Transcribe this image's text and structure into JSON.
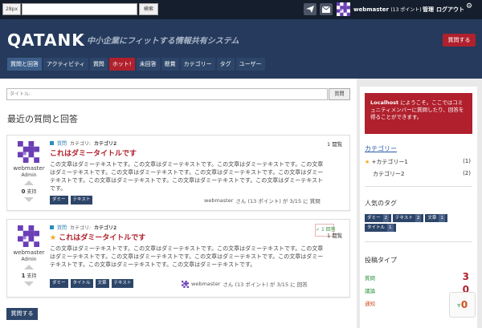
{
  "topbar": {
    "logo_text": "28px",
    "search_button": "検索",
    "user_name": "webmaster",
    "user_points": "(13 ポイント)",
    "admin_link": "管理",
    "logout_link": "ログアウト"
  },
  "header": {
    "site_title": "QATANK",
    "tagline": "中小企業にフィットする情報共有システム",
    "ask_button": "質問する",
    "nav": [
      {
        "label": "質問と回答"
      },
      {
        "label": "アクティビティ"
      },
      {
        "label": "質問"
      },
      {
        "label": "ホット!"
      },
      {
        "label": "未回答"
      },
      {
        "label": "懸賞"
      },
      {
        "label": "カテゴリー"
      },
      {
        "label": "タグ"
      },
      {
        "label": "ユーザー"
      }
    ]
  },
  "main": {
    "title_input_placeholder": "タイトル:",
    "question_button": "質問",
    "heading": "最近の質問と回答",
    "ask_button": "質問する",
    "questions": [
      {
        "type": "質問",
        "category_label": "カテゴリ:",
        "category": "カテゴリ2",
        "title": "これはダミータイトルです",
        "body": "この文章はダミーテキストです。この文章はダミーテキストです。この文章はダミーテキストです。この文章はダミーテキストです。この文章はダミーテキストです。この文章はダミーテキストです。この文章はダミーテキストです。この文章はダミーテキストです。この文章はダミーテキストです。この文章はダミーテキストです。",
        "author": "webmaster",
        "role": "Admin",
        "votes": "0",
        "votes_label": "支持",
        "views": "1 閲覧",
        "tags": [
          "ダミー",
          "テキスト"
        ],
        "footer_user": "webmaster",
        "footer_rest": "さん (13 ポイント) が 3/15 に 質問"
      },
      {
        "type": "質問",
        "category_label": "カテゴリ:",
        "category": "カテゴリ2",
        "star": "★",
        "title": "これはダミータイトルです",
        "body": "この文章はダミーテキストです。この文章はダミーテキストです。この文章はダミーテキストです。この文章はダミーテキストです。この文章はダミーテキストです。この文章はダミーテキストです。この文章はダミーテキストです。この文章はダミーテキストです。この文章はダミーテキストです。",
        "author": "webmaster",
        "role": "Admin",
        "votes": "1",
        "votes_label": "支持",
        "views": "1 閲覧",
        "answers": "1 回答",
        "tags": [
          "ダミー",
          "タイトル",
          "文章",
          "テキスト"
        ],
        "footer_user": "webmaster",
        "footer_rest": "さん (13 ポイント) が 3/15 に 回答"
      }
    ]
  },
  "sidebar": {
    "welcome_bold": "Localhost",
    "welcome_text": " にようこそ。ここではコミュニティメンバーに質問したり、回答を得ることができます。",
    "categories_heading": "カテゴリー",
    "categories": [
      {
        "star": "★",
        "label": "+カテゴリー1",
        "count": "(1)"
      },
      {
        "label": "カテゴリー2",
        "count": "(2)"
      }
    ],
    "popular_tags_heading": "人気のタグ",
    "popular_tags": [
      {
        "label": "ダミー",
        "count": "2"
      },
      {
        "label": "テキスト",
        "count": "2"
      },
      {
        "label": "文章",
        "count": "1"
      },
      {
        "label": "タイトル",
        "count": "1"
      }
    ],
    "post_types_heading": "投稿タイプ",
    "post_types": [
      {
        "label": "質問",
        "value": "3",
        "color": "#2a8f3a",
        "value_color": "#b0202d"
      },
      {
        "label": "議論",
        "value": "0",
        "color": "#2a8f3a",
        "value_color": "#b0202d"
      },
      {
        "label": "通知",
        "value": "0",
        "color": "#d0501f",
        "value_color": "#d0501f"
      }
    ],
    "scroll_top_value": "0"
  },
  "colors": {
    "topbar": "#141e2d",
    "header": "#253a5c",
    "accent_red": "#b0202d",
    "nav_item": "#2d4569"
  }
}
